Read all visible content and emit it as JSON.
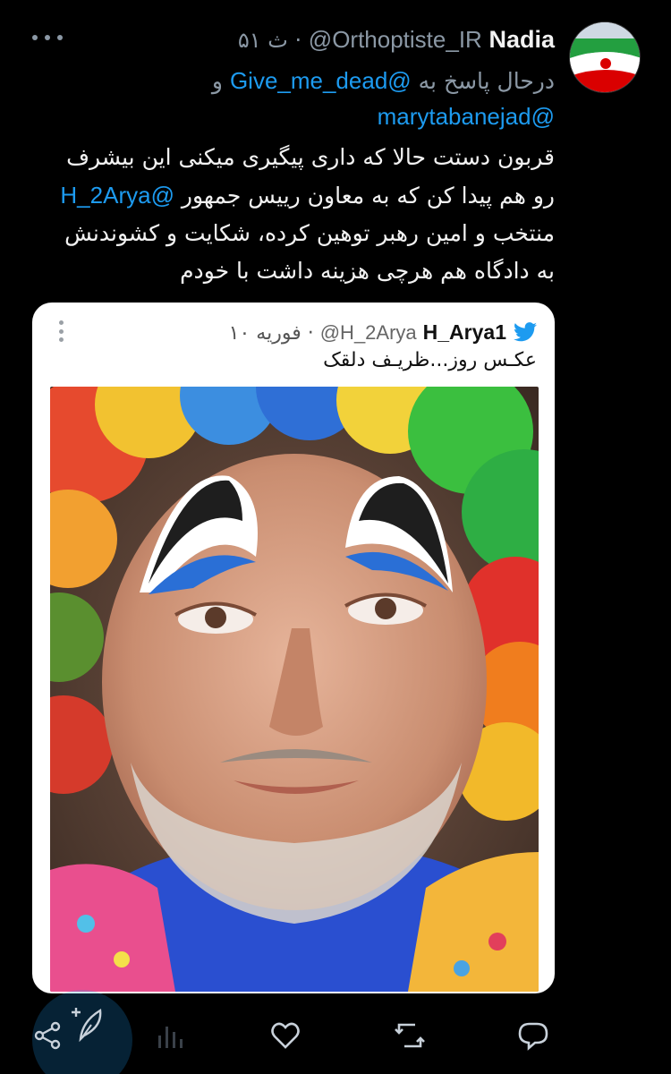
{
  "tweet": {
    "author_name": "Nadia",
    "author_handle": "@Orthoptiste_IR",
    "separator": "·",
    "time": "ث ۵۱",
    "reply_prefix": "درحال پاسخ به",
    "reply_mention_1": "@Give_me_dead",
    "reply_and": "و",
    "reply_mention_2": "@marytabanejad",
    "body_line_1": "قربون دستت حالا که داری پیگیری میکنی این بیشرف",
    "body_mention": "@H_2Arya",
    "body_line_2_rest": "رو هم پیدا کن که به معاون رییس جمهور",
    "body_line_3": "منتخب و امین رهبر توهین کرده، شکایت و کشوندنش",
    "body_line_4": "به دادگاه هم هرچی هزینه داشت با خودم"
  },
  "embedded": {
    "author_name": "H_Arya1",
    "author_handle": "@H_2Arya",
    "separator": "·",
    "date": "۱۰ فوریه",
    "caption": "عکـس روز...ظریـف دلقک"
  },
  "icons": {
    "avatar": "iran-flag-avatar",
    "more": "more-horizontal-icon",
    "card_more": "more-vertical-icon",
    "bird": "twitter-bird-icon",
    "share": "share-icon",
    "compose": "compose-feather-icon",
    "analytics": "analytics-icon",
    "like": "heart-icon",
    "retweet": "retweet-icon",
    "reply": "reply-icon"
  },
  "colors": {
    "background": "#000000",
    "link": "#1d9bf0",
    "muted": "#8b98a5",
    "text": "#f2f2f2",
    "card_bg": "#ffffff"
  }
}
